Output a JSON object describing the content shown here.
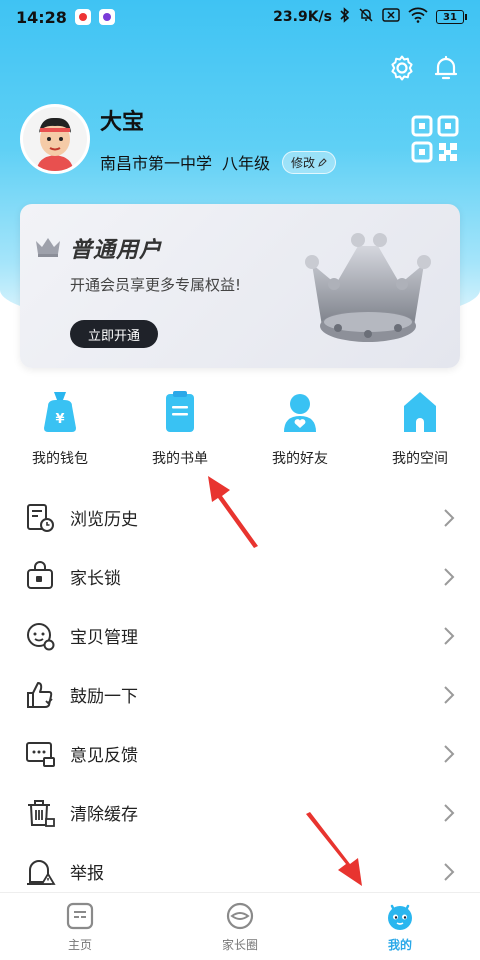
{
  "status_bar": {
    "time": "14:28",
    "network_speed": "23.9K/s",
    "battery": "31"
  },
  "profile": {
    "name": "大宝",
    "school": "南昌市第一中学",
    "grade": "八年级",
    "edit_label": "修改"
  },
  "vip_card": {
    "title": "普通用户",
    "subtitle": "开通会员享更多专属权益!",
    "button_label": "立即开通"
  },
  "shortcuts": [
    {
      "label": "我的钱包",
      "icon": "wallet-icon"
    },
    {
      "label": "我的书单",
      "icon": "booklist-icon"
    },
    {
      "label": "我的好友",
      "icon": "friends-icon"
    },
    {
      "label": "我的空间",
      "icon": "space-icon"
    }
  ],
  "menu": [
    {
      "label": "浏览历史",
      "icon": "history-icon"
    },
    {
      "label": "家长锁",
      "icon": "parent-lock-icon"
    },
    {
      "label": "宝贝管理",
      "icon": "baby-manage-icon"
    },
    {
      "label": "鼓励一下",
      "icon": "thumbs-up-icon"
    },
    {
      "label": "意见反馈",
      "icon": "feedback-icon"
    },
    {
      "label": "清除缓存",
      "icon": "trash-icon"
    },
    {
      "label": "举报",
      "icon": "report-icon"
    }
  ],
  "tabbar": [
    {
      "label": "主页",
      "icon": "home-icon",
      "active": false
    },
    {
      "label": "家长圈",
      "icon": "parent-circle-icon",
      "active": false
    },
    {
      "label": "我的",
      "icon": "mine-icon",
      "active": true
    }
  ],
  "colors": {
    "header_gradient_top": "#3fc3f3",
    "accent": "#2aa8e8",
    "arrow_red": "#e8342f",
    "vip_button": "#1f2229"
  }
}
